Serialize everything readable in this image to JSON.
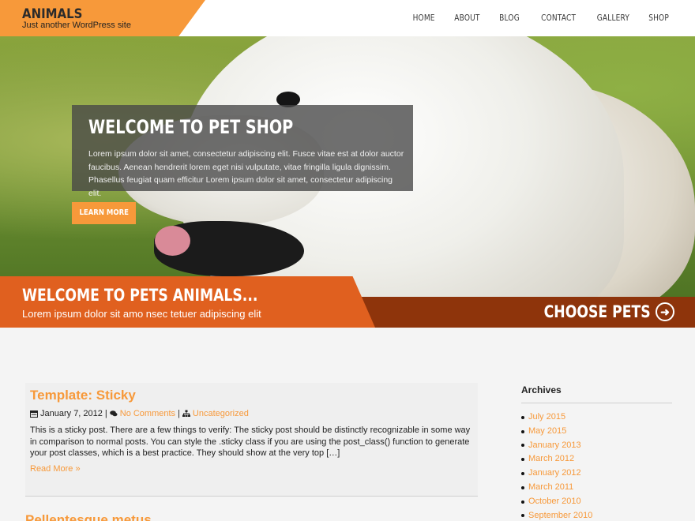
{
  "header": {
    "site_title": "ANIMALS",
    "site_description": "Just another WordPress site",
    "nav": [
      "HOME",
      "ABOUT",
      "BLOG",
      "CONTACT",
      "GALLERY",
      "SHOP"
    ]
  },
  "hero": {
    "title": "WELCOME TO PET SHOP",
    "text": "Lorem ipsum dolor sit amet, consectetur adipiscing elit. Fusce vitae est at dolor auctor faucibus. Aenean hendrerit lorem eget nisi vulputate, vitae fringilla ligula dignissim. Phasellus feugiat quam efficitur Lorem ipsum dolor sit amet, consectetur adipiscing elit.",
    "button": "LEARN MORE"
  },
  "banner": {
    "title": "WELCOME TO PETS ANIMALS...",
    "subtitle": "Lorem ipsum dolor sit amo nsec tetuer adipiscing elit",
    "cta": "CHOOSE PETS",
    "cta_icon": "arrow-circle-right-icon"
  },
  "post": {
    "title": "Template: Sticky",
    "date": "January 7, 2012",
    "separator": "|",
    "comments": "No Comments",
    "category": "Uncategorized",
    "body": "This is a sticky post. There are a few things to verify: The sticky post should be distinctly recognizable in some way in comparison to normal posts. You can style the .sticky class if you are using the post_class() function to generate your post classes, which is a best practice. They should show at the very top […]",
    "read_more": "Read More »"
  },
  "post2": {
    "title": "Pellentesque metus"
  },
  "sidebar": {
    "title": "Archives",
    "items": [
      "July 2015",
      "May 2015",
      "January 2013",
      "March 2012",
      "January 2012",
      "March 2011",
      "October 2010",
      "September 2010"
    ]
  },
  "colors": {
    "accent": "#f7993a",
    "banner_orange": "#e0601f",
    "banner_dark": "#8e340b"
  }
}
